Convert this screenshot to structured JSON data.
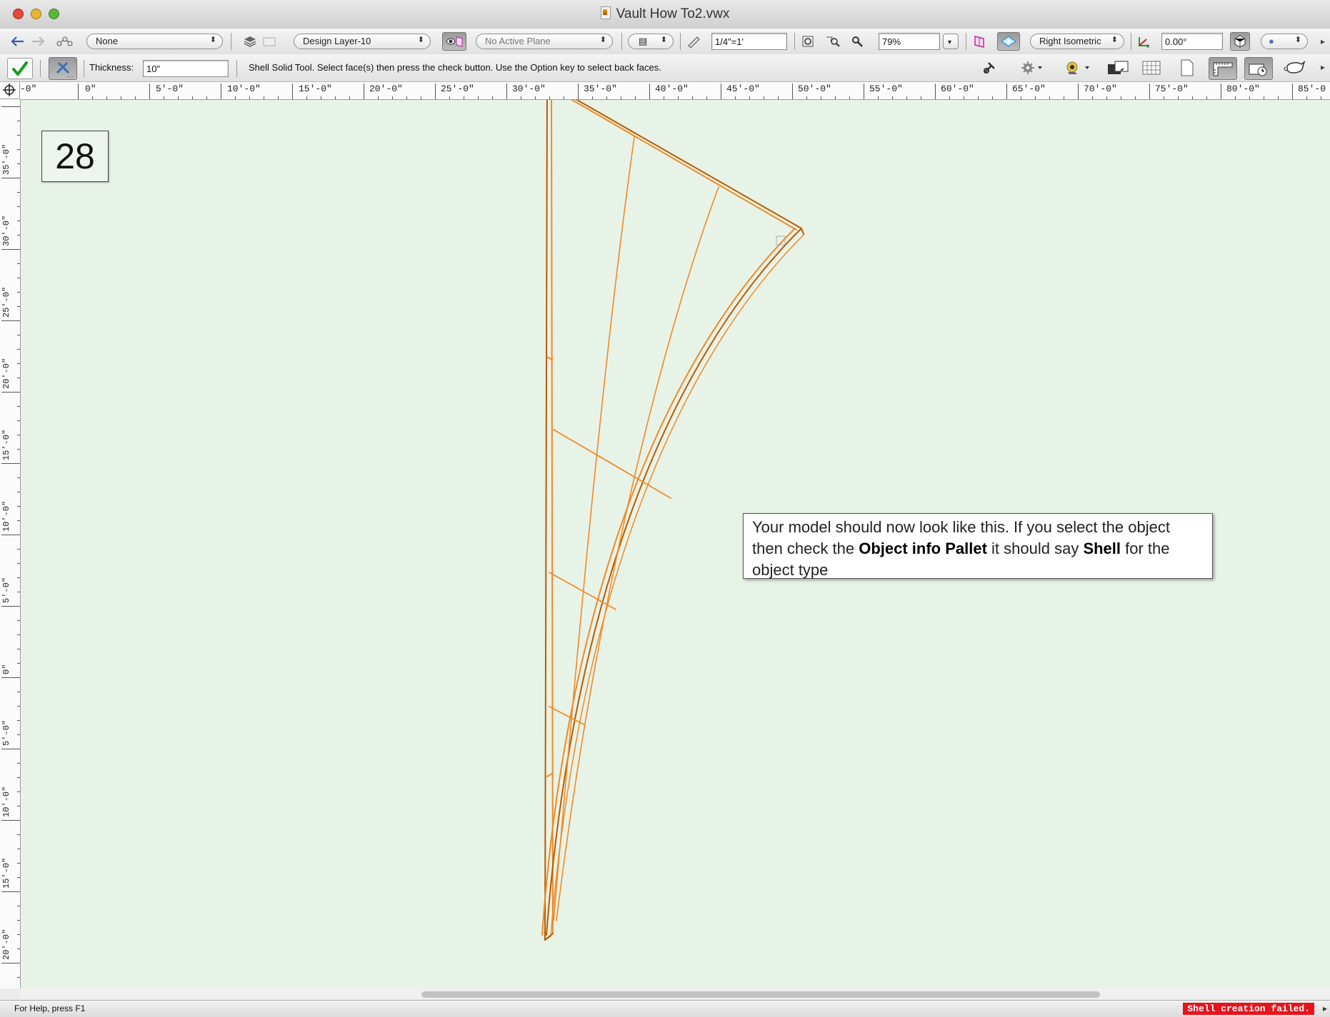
{
  "window": {
    "title": "Vault How To2.vwx"
  },
  "toolbar1": {
    "class_popup": "None",
    "layer_popup": "Design Layer-10",
    "plane_popup": "No Active Plane",
    "scale_field": "1/4\"=1'",
    "zoom_field": "79%",
    "view_popup": "Right Isometric",
    "angle_field": "0.00°"
  },
  "toolbar2": {
    "thickness_label": "Thickness:",
    "thickness_value": "10\"",
    "tool_hint": "Shell Solid Tool. Select face(s) then press the check button. Use the Option key to select back faces."
  },
  "ruler": {
    "horizontal": [
      "-0\"",
      "0\"",
      "5'-0\"",
      "10'-0\"",
      "15'-0\"",
      "20'-0\"",
      "25'-0\"",
      "30'-0\"",
      "35'-0\"",
      "40'-0\"",
      "45'-0\"",
      "50'-0\"",
      "55'-0\"",
      "60'-0\"",
      "65'-0\"",
      "70'-0\"",
      "75'-0\"",
      "80'-0\"",
      "85'-0"
    ],
    "vertical": [
      "35'-0\"",
      "30'-0\"",
      "25'-0\"",
      "20'-0\"",
      "15'-0\"",
      "10'-0\"",
      "5'-0\"",
      "0\"",
      "5'-0\"",
      "10'-0\"",
      "15'-0\"",
      "20'-0\""
    ]
  },
  "canvas": {
    "step_number": "28",
    "note": {
      "text1": "Your model should now look like this. If you select the object then check the ",
      "bold1": "Object info Pallet",
      "text2": " it should say ",
      "bold2": "Shell",
      "text3": " for the object type"
    },
    "model_color": "#f08a24",
    "model_edge_color": "#b85c00"
  },
  "status": {
    "help": "For Help, press F1",
    "error": "Shell creation failed."
  },
  "icons": [
    "back-arrow-icon",
    "forward-arrow-icon",
    "class-icon",
    "layers-icon",
    "eye-plane-icon",
    "page-icon",
    "ruler-icon",
    "zoom-fit-icon",
    "zoom-selection-icon",
    "magnifier-icon",
    "working-plane-icon",
    "projection-icon",
    "axis-icon",
    "render-mode-icon",
    "checkmark-icon",
    "mode-tool-icon",
    "snap-icon",
    "gear-icon",
    "visibility-icon",
    "layer-stack-icon",
    "grid-icon",
    "page-blank-icon",
    "ruler-toggle-icon",
    "clock-icon",
    "teapot-icon"
  ]
}
